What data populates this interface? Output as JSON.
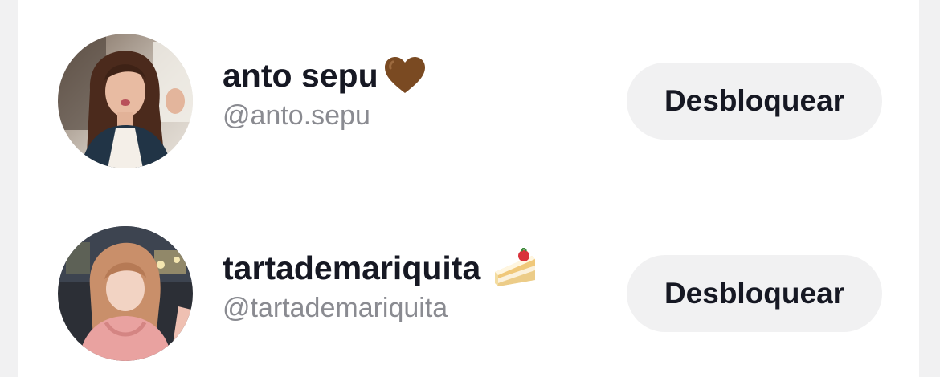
{
  "blocked_accounts": [
    {
      "display_name": "anto sepu",
      "emoji_icon": "brown-heart-icon",
      "handle": "@anto.sepu",
      "button_label": "Desbloquear"
    },
    {
      "display_name": "tartademariquita",
      "emoji_icon": "shortcake-icon",
      "handle": "@tartademariquita",
      "button_label": "Desbloquear"
    }
  ],
  "colors": {
    "page_background": "#f1f1f2",
    "list_background": "#ffffff",
    "primary_text": "#161823",
    "secondary_text": "#8a8b91",
    "button_background": "#f1f1f2"
  }
}
